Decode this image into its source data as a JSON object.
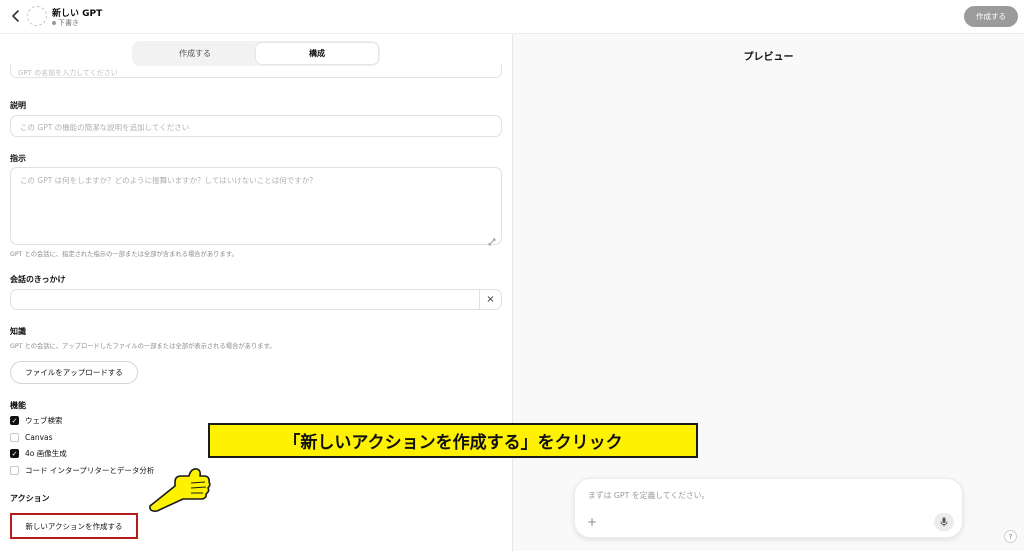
{
  "header": {
    "gpt_name": "新しい GPT",
    "status": "下書き",
    "create_label": "作成する"
  },
  "tabs": [
    {
      "label": "作成する",
      "active": false
    },
    {
      "label": "構成",
      "active": true
    }
  ],
  "form": {
    "cut_off_placeholder": "GPT の名前を入力してください",
    "description": {
      "label": "説明",
      "placeholder": "この GPT の機能の簡潔な説明を追加してください"
    },
    "instructions": {
      "label": "指示",
      "placeholder": "この GPT は何をしますか？どのように振舞いますか？してはいけないことは何ですか？",
      "hint": "GPT との会話に、指定された指示の一部または全部が含まれる場合があります。"
    },
    "starters": {
      "label": "会話のきっかけ",
      "clear": "×"
    },
    "knowledge": {
      "label": "知識",
      "hint": "GPT との会話に、アップロードしたファイルの一部または全部が表示される場合があります。",
      "upload_label": "ファイルをアップロードする"
    },
    "capabilities": {
      "label": "機能",
      "items": [
        {
          "label": "ウェブ検索",
          "checked": true
        },
        {
          "label": "Canvas",
          "checked": false
        },
        {
          "label": "4o 画像生成",
          "checked": true
        },
        {
          "label": "コード インタープリターとデータ分析",
          "checked": false
        }
      ]
    },
    "actions": {
      "label": "アクション",
      "new_action_label": "新しいアクションを作成する"
    }
  },
  "preview": {
    "title": "プレビュー",
    "composer_placeholder": "まずは GPT を定義してください。",
    "plus": "+",
    "help": "?"
  },
  "annotation": {
    "text": "「新しいアクションを作成する」をクリック",
    "callout_color": "#fff200",
    "highlight_color": "#b51b1b",
    "pointer_icon": "pointing-hand-icon"
  }
}
